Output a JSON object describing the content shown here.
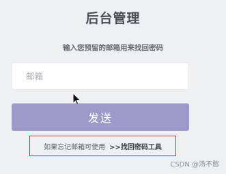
{
  "header": {
    "title": "后台管理",
    "subtitle": "输入您预留的邮箱用来找回密码"
  },
  "form": {
    "email_placeholder": "邮箱",
    "email_value": "",
    "send_label": "发送"
  },
  "hint": {
    "text": "如果忘记邮箱可使用",
    "link_label": ">>找回密码工具"
  },
  "watermark": "CSDN @汤不憨",
  "colors": {
    "background": "#eff0f3",
    "button": "#9d99c9",
    "highlight_border": "#d6262a"
  },
  "icons": {
    "cursor": "mouse-pointer-icon"
  }
}
